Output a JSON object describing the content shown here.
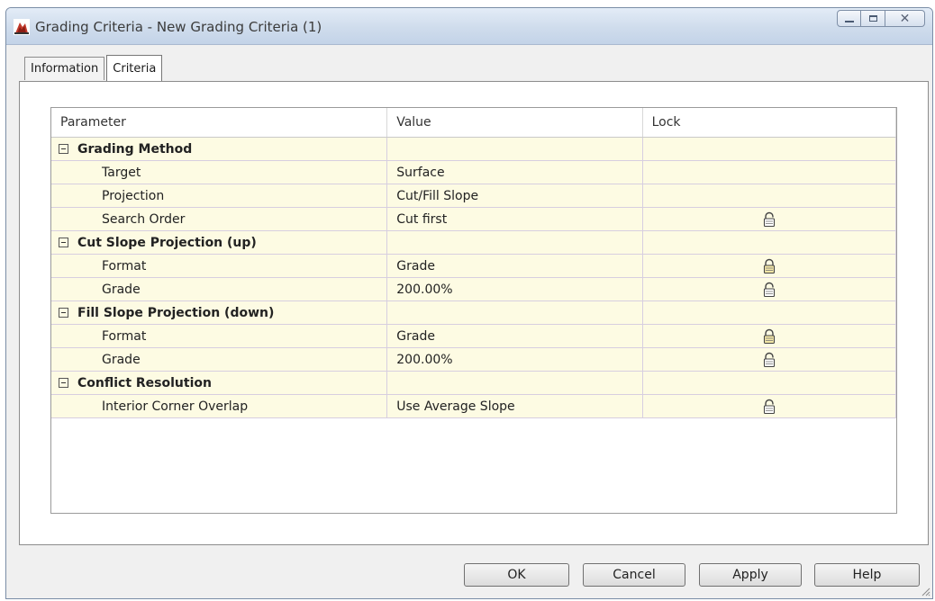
{
  "window": {
    "title": "Grading Criteria - New Grading Criteria (1)",
    "close_glyph": "✕"
  },
  "tabs": [
    {
      "label": "Information",
      "active": false
    },
    {
      "label": "Criteria",
      "active": true
    }
  ],
  "grid": {
    "headers": [
      "Parameter",
      "Value",
      "Lock"
    ],
    "rows": [
      {
        "type": "group",
        "parameter": "Grading Method",
        "value": "",
        "lock": "none"
      },
      {
        "type": "item",
        "parameter": "Target",
        "value": "Surface",
        "lock": "none"
      },
      {
        "type": "item",
        "parameter": "Projection",
        "value": "Cut/Fill Slope",
        "lock": "none"
      },
      {
        "type": "item",
        "parameter": "Search Order",
        "value": "Cut first",
        "lock": "unlocked"
      },
      {
        "type": "group",
        "parameter": "Cut Slope Projection (up)",
        "value": "",
        "lock": "none"
      },
      {
        "type": "item",
        "parameter": "Format",
        "value": "Grade",
        "lock": "locked"
      },
      {
        "type": "item",
        "parameter": "Grade",
        "value": "200.00%",
        "lock": "unlocked"
      },
      {
        "type": "group",
        "parameter": "Fill Slope Projection (down)",
        "value": "",
        "lock": "none"
      },
      {
        "type": "item",
        "parameter": "Format",
        "value": "Grade",
        "lock": "locked"
      },
      {
        "type": "item",
        "parameter": "Grade",
        "value": "200.00%",
        "lock": "unlocked"
      },
      {
        "type": "group",
        "parameter": "Conflict Resolution",
        "value": "",
        "lock": "none"
      },
      {
        "type": "item",
        "parameter": "Interior Corner Overlap",
        "value": "Use Average Slope",
        "lock": "unlocked"
      }
    ]
  },
  "buttons": {
    "ok": "OK",
    "cancel": "Cancel",
    "apply": "Apply",
    "help": "Help"
  },
  "colors": {
    "row_background": "#fdfbe3",
    "row_divider": "#d7cee0",
    "titlebar": "#cfdcec"
  }
}
